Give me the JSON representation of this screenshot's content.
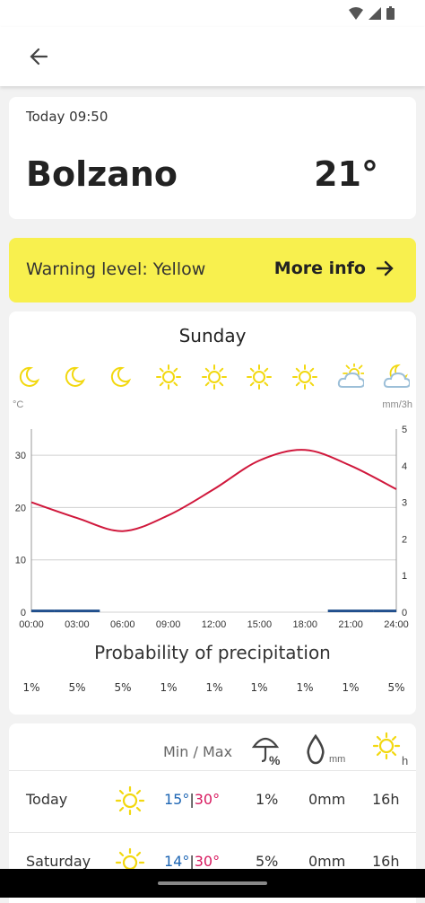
{
  "header": {
    "back_label": "back"
  },
  "current": {
    "time": "Today 09:50",
    "city": "Bolzano",
    "temp": "21°"
  },
  "warning": {
    "text": "Warning level: Yellow",
    "more": "More info"
  },
  "forecast": {
    "day": "Sunday",
    "icons": [
      "moon",
      "moon",
      "moon",
      "sun",
      "sun",
      "sun",
      "sun",
      "cloud-sun",
      "cloud-moon"
    ],
    "precip_title": "Probability of precipitation",
    "precip": [
      "1%",
      "5%",
      "5%",
      "1%",
      "1%",
      "1%",
      "1%",
      "1%",
      "5%"
    ]
  },
  "chart_data": {
    "type": "line",
    "x": [
      "00:00",
      "03:00",
      "06:00",
      "09:00",
      "12:00",
      "15:00",
      "18:00",
      "21:00",
      "24:00"
    ],
    "series": [
      {
        "values": [
          21,
          18,
          15.5,
          18.5,
          23.5,
          29,
          31,
          28,
          23.5
        ]
      }
    ],
    "bars": {
      "values": [
        0.07,
        0.07,
        0,
        0,
        0,
        0,
        0,
        0.07,
        0.07
      ]
    },
    "ylabel_left": "°C",
    "ylabel_right": "mm/3h",
    "yticks_left": [
      "0",
      "10",
      "20",
      "30"
    ],
    "yticks_right": [
      "0",
      "1",
      "2",
      "3",
      "4",
      "5"
    ],
    "ylim_left": [
      0,
      35
    ],
    "ylim_right": [
      0,
      5
    ],
    "colors": {
      "line": "#d0183c",
      "bars": "#1f4e8c",
      "grid": "#d0d0d0"
    }
  },
  "table": {
    "minmax_header": "Min / Max",
    "prob_unit": "%",
    "mm_unit": "mm",
    "sun_unit": "h",
    "rows": [
      {
        "label": "Today",
        "min": "15°",
        "max": "30°",
        "prob": "1%",
        "mm": "0mm",
        "sun": "16h",
        "icon": "sun"
      },
      {
        "label": "Saturday",
        "min": "14°",
        "max": "30°",
        "prob": "5%",
        "mm": "0mm",
        "sun": "16h",
        "icon": "sun"
      }
    ]
  },
  "colors": {
    "accent_yellow": "#f8f04e",
    "sun_yellow": "#f2d80f",
    "cloud_blue": "#9cbfd8"
  }
}
